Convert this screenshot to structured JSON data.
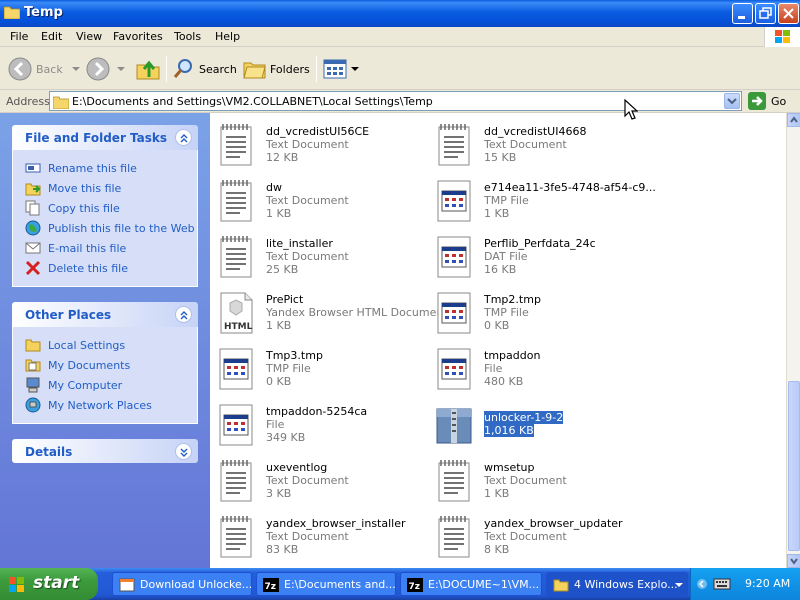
{
  "window": {
    "title": "Temp",
    "controls": [
      "minimize",
      "maximize",
      "close"
    ]
  },
  "menu": [
    "File",
    "Edit",
    "View",
    "Favorites",
    "Tools",
    "Help"
  ],
  "toolbar": {
    "back_label": "Back",
    "search_label": "Search",
    "folders_label": "Folders"
  },
  "address": {
    "label": "Address",
    "path": "E:\\Documents and Settings\\VM2.COLLABNET\\Local Settings\\Temp",
    "go_label": "Go"
  },
  "sidebar": {
    "file_tasks": {
      "title": "File and Folder Tasks",
      "items": [
        {
          "label": "Rename this file",
          "icon": "rename-icon"
        },
        {
          "label": "Move this file",
          "icon": "move-icon"
        },
        {
          "label": "Copy this file",
          "icon": "copy-icon"
        },
        {
          "label": "Publish this file to the Web",
          "icon": "globe-icon"
        },
        {
          "label": "E-mail this file",
          "icon": "email-icon"
        },
        {
          "label": "Delete this file",
          "icon": "delete-x-icon"
        }
      ]
    },
    "other_places": {
      "title": "Other Places",
      "items": [
        {
          "label": "Local Settings",
          "icon": "folder-icon"
        },
        {
          "label": "My Documents",
          "icon": "my-documents-icon"
        },
        {
          "label": "My Computer",
          "icon": "my-computer-icon"
        },
        {
          "label": "My Network Places",
          "icon": "network-places-icon"
        }
      ]
    },
    "details": {
      "title": "Details"
    }
  },
  "files": [
    {
      "name": "dd_vcredistUI56CE",
      "type": "Text Document",
      "size": "12 KB",
      "icon": "text-document-icon"
    },
    {
      "name": "dd_vcredistUI4668",
      "type": "Text Document",
      "size": "15 KB",
      "icon": "text-document-icon"
    },
    {
      "name": "dw",
      "type": "Text Document",
      "size": "1 KB",
      "icon": "text-document-icon"
    },
    {
      "name": "e714ea11-3fe5-4748-af54-c9...",
      "type": "TMP File",
      "size": "1 KB",
      "icon": "generic-file-icon"
    },
    {
      "name": "lite_installer",
      "type": "Text Document",
      "size": "25 KB",
      "icon": "text-document-icon"
    },
    {
      "name": "Perflib_Perfdata_24c",
      "type": "DAT File",
      "size": "16 KB",
      "icon": "generic-file-icon"
    },
    {
      "name": "PrePict",
      "type": "Yandex Browser HTML Document",
      "size": "1 KB",
      "icon": "html-document-icon",
      "icon_label": "HTML"
    },
    {
      "name": "Tmp2.tmp",
      "type": "TMP File",
      "size": "0 KB",
      "icon": "generic-file-icon"
    },
    {
      "name": "Tmp3.tmp",
      "type": "TMP File",
      "size": "0 KB",
      "icon": "generic-file-icon"
    },
    {
      "name": "tmpaddon",
      "type": "File",
      "size": "480 KB",
      "icon": "generic-file-icon"
    },
    {
      "name": "tmpaddon-5254ca",
      "type": "File",
      "size": "349 KB",
      "icon": "generic-file-icon"
    },
    {
      "name": "unlocker-1-9-2",
      "type": "",
      "size": "1,016 KB",
      "icon": "zip-archive-icon",
      "selected": true
    },
    {
      "name": "uxeventlog",
      "type": "Text Document",
      "size": "3 KB",
      "icon": "text-document-icon"
    },
    {
      "name": "wmsetup",
      "type": "Text Document",
      "size": "1 KB",
      "icon": "text-document-icon"
    },
    {
      "name": "yandex_browser_installer",
      "type": "Text Document",
      "size": "83 KB",
      "icon": "text-document-icon"
    },
    {
      "name": "yandex_browser_updater",
      "type": "Text Document",
      "size": "8 KB",
      "icon": "text-document-icon"
    }
  ],
  "taskbar": {
    "start_label": "start",
    "buttons": [
      {
        "label": "Download Unlocke...",
        "icon": "browser-icon"
      },
      {
        "label": "E:\\Documents and...",
        "icon": "7zip-icon",
        "icon_label": "7z"
      },
      {
        "label": "E:\\DOCUME~1\\VM...",
        "icon": "7zip-icon",
        "icon_label": "7z"
      },
      {
        "label": "4 Windows Explo...",
        "icon": "folder-icon"
      }
    ],
    "clock": "9:20 AM"
  }
}
